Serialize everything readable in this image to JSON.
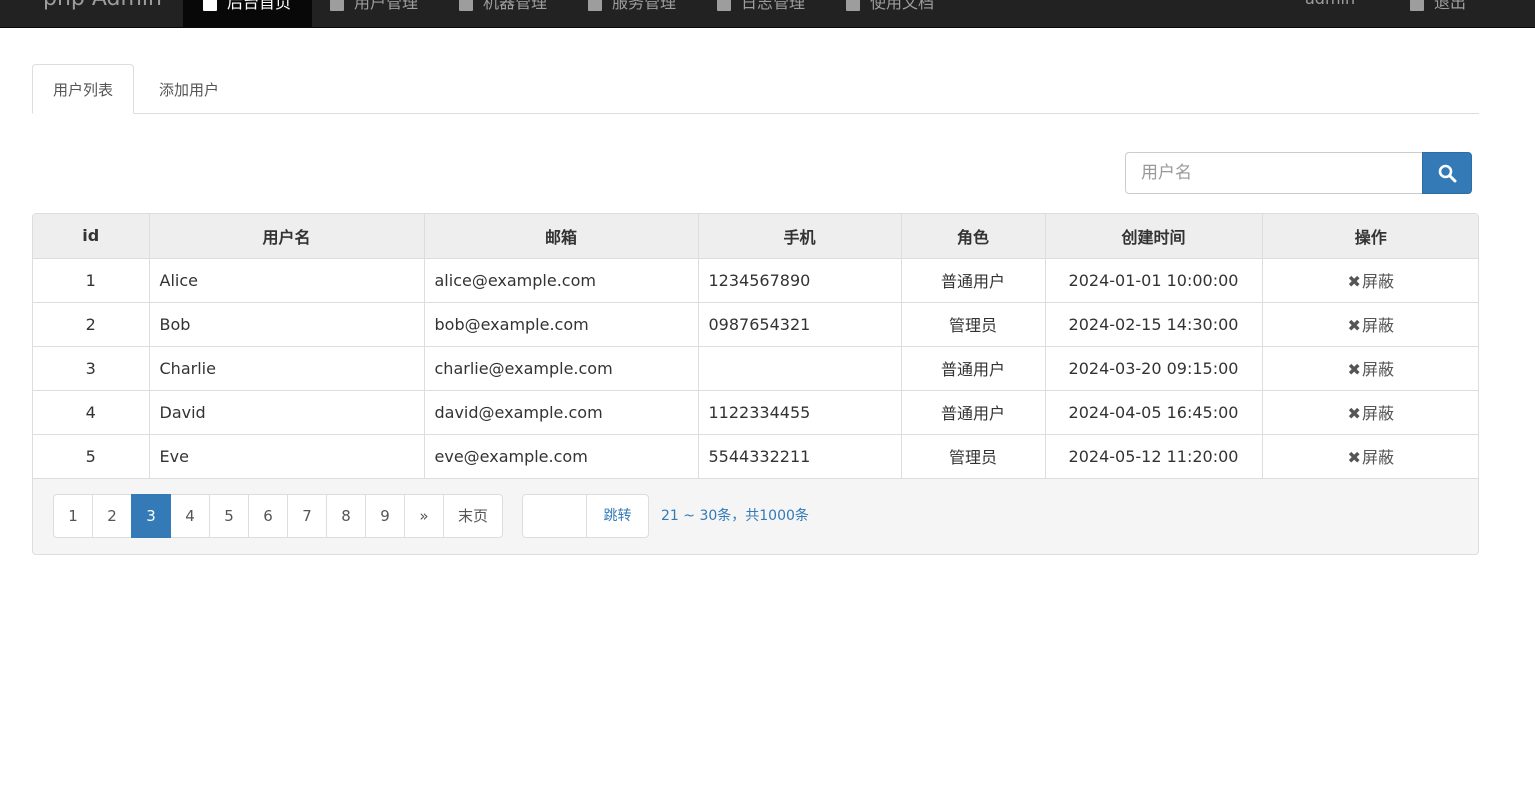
{
  "navbar": {
    "brand": "php Admin",
    "items": [
      {
        "label": "后台首页",
        "icon": "dashboard-icon",
        "active": true
      },
      {
        "label": "用户管理",
        "icon": "user-icon"
      },
      {
        "label": "机器管理",
        "icon": "database-icon"
      },
      {
        "label": "服务管理",
        "icon": "list-icon"
      },
      {
        "label": "日志管理",
        "icon": "file-icon"
      },
      {
        "label": "使用文档",
        "icon": "book-icon"
      }
    ],
    "user": "admin",
    "logout": "退出"
  },
  "tabs": {
    "list": "用户列表",
    "add": "添加用户"
  },
  "search": {
    "placeholder": "用户名"
  },
  "table": {
    "headers": [
      "id",
      "用户名",
      "邮箱",
      "手机",
      "角色",
      "创建时间",
      "操作"
    ],
    "rows": [
      {
        "id": "1",
        "name": "Alice",
        "email": "alice@example.com",
        "phone": "1234567890",
        "role": "普通用户",
        "created": "2024-01-01 10:00:00",
        "action": "屏蔽"
      },
      {
        "id": "2",
        "name": "Bob",
        "email": "bob@example.com",
        "phone": "0987654321",
        "role": "管理员",
        "created": "2024-02-15 14:30:00",
        "action": "屏蔽"
      },
      {
        "id": "3",
        "name": "Charlie",
        "email": "charlie@example.com",
        "phone": "",
        "role": "普通用户",
        "created": "2024-03-20 09:15:00",
        "action": "屏蔽"
      },
      {
        "id": "4",
        "name": "David",
        "email": "david@example.com",
        "phone": "1122334455",
        "role": "普通用户",
        "created": "2024-04-05 16:45:00",
        "action": "屏蔽"
      },
      {
        "id": "5",
        "name": "Eve",
        "email": "eve@example.com",
        "phone": "5544332211",
        "role": "管理员",
        "created": "2024-05-12 11:20:00",
        "action": "屏蔽"
      }
    ]
  },
  "pagination": {
    "pages": [
      "1",
      "2",
      "3",
      "4",
      "5",
      "6",
      "7",
      "8",
      "9"
    ],
    "active_page": "3",
    "next": "»",
    "last": "末页",
    "jump_label": "跳转",
    "range_text": "21 ~ 30条，共1000条"
  },
  "colors": {
    "primary": "#337ab7",
    "navbar_bg": "#222222",
    "header_bg": "#eeeeee"
  }
}
